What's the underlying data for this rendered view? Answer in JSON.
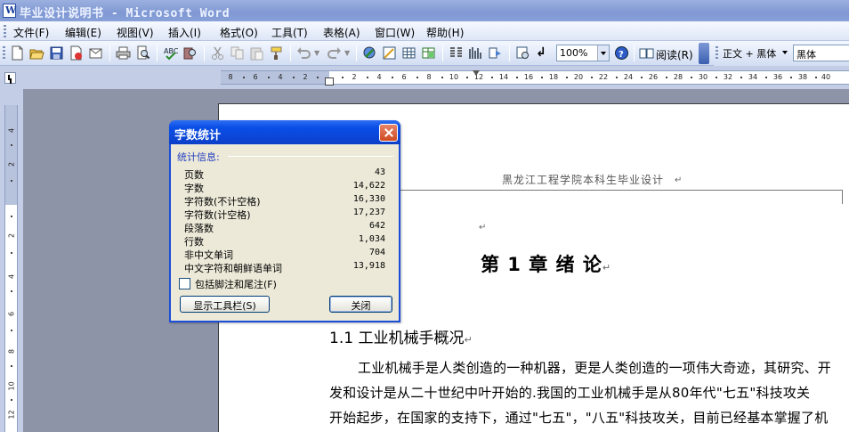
{
  "window": {
    "title": "毕业设计说明书 - Microsoft Word"
  },
  "menu": [
    "文件(F)",
    "编辑(E)",
    "视图(V)",
    "插入(I)",
    "格式(O)",
    "工具(T)",
    "表格(A)",
    "窗口(W)",
    "帮助(H)"
  ],
  "toolbar": {
    "zoom": "100%",
    "read_label": "阅读(R)",
    "style": "正文 + 黑体",
    "font": "黑体",
    "icons": [
      "new-icon",
      "open-icon",
      "save-icon",
      "permission-icon",
      "email-icon",
      "print-icon",
      "print-preview-icon",
      "spelling-icon",
      "research-icon",
      "cut-icon",
      "copy-icon",
      "paste-icon",
      "format-painter-icon",
      "undo-icon",
      "redo-icon",
      "hyperlink-icon",
      "tables-borders-icon",
      "insert-table-icon",
      "insert-excel-icon",
      "columns-icon",
      "drawing-icon",
      "document-map-icon",
      "show-hide-icon",
      "help-icon",
      "read-icon"
    ]
  },
  "ruler": {
    "h_ticks": [
      "8",
      "6",
      "4",
      "2",
      "2",
      "4",
      "6",
      "8",
      "10",
      "12",
      "14",
      "16",
      "18",
      "20",
      "22",
      "24",
      "26",
      "28",
      "30",
      "32",
      "34",
      "36",
      "38",
      "40"
    ],
    "v_ticks": [
      "4",
      "2",
      "2",
      "4",
      "6",
      "8",
      "10",
      "12"
    ]
  },
  "document": {
    "header": "黑龙江工程学院本科生毕业设计",
    "chapter_title": "第 1 章  绪    论",
    "section_title": "1.1  工业机械手概况",
    "body_lines": [
      "工业机械手是人类创造的一种机器，更是人类创造的一项伟大奇迹，其研究、开",
      "发和设计是从二十世纪中叶开始的.我国的工业机械手是从80年代\"七五\"科技攻关",
      "开始起步，在国家的支持下，通过\"七五\"，\"八五\"科技攻关，目前已经基本掌握了机"
    ]
  },
  "dialog": {
    "title": "字数统计",
    "group_label": "统计信息:",
    "stats": [
      {
        "label": "页数",
        "value": "43"
      },
      {
        "label": "字数",
        "value": "14,622"
      },
      {
        "label": "字符数(不计空格)",
        "value": "16,330"
      },
      {
        "label": "字符数(计空格)",
        "value": "17,237"
      },
      {
        "label": "段落数",
        "value": "642"
      },
      {
        "label": "行数",
        "value": "1,034"
      },
      {
        "label": "非中文单词",
        "value": "704"
      },
      {
        "label": "中文字符和朝鲜语单词",
        "value": "13,918"
      }
    ],
    "checkbox_label": "包括脚注和尾注(F)",
    "show_toolbar_button": "显示工具栏(S)",
    "close_button": "关闭"
  }
}
